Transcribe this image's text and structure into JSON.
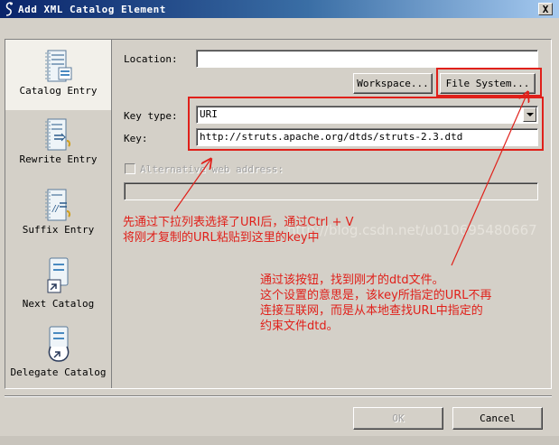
{
  "window": {
    "title": "Add XML Catalog Element",
    "close_label": "X"
  },
  "sidebar": {
    "items": [
      {
        "label": "Catalog Entry",
        "icon": "catalog-entry-icon",
        "selected": true
      },
      {
        "label": "Rewrite Entry",
        "icon": "rewrite-entry-icon",
        "selected": false
      },
      {
        "label": "Suffix Entry",
        "icon": "suffix-entry-icon",
        "selected": false
      },
      {
        "label": "Next Catalog",
        "icon": "next-catalog-icon",
        "selected": false
      },
      {
        "label": "Delegate Catalog",
        "icon": "delegate-catalog-icon",
        "selected": false
      }
    ]
  },
  "form": {
    "location_label": "Location:",
    "location_value": "",
    "workspace_button": "Workspace...",
    "file_system_button": "File System...",
    "key_type_label": "Key type:",
    "key_type_value": "URI",
    "key_label": "Key:",
    "key_value": "http://struts.apache.org/dtds/struts-2.3.dtd",
    "alt_web_label": "Alternative web address:",
    "alt_web_checked": false,
    "alt_web_value": ""
  },
  "annotations": {
    "note1": [
      "先通过下拉列表选择了URI后，通过Ctrl + V",
      "将刚才复制的URL粘贴到这里的key中"
    ],
    "note2": [
      "通过该按钮，找到刚才的dtd文件。",
      "这个设置的意思是，该key所指定的URL不再",
      "连接互联网，而是从本地查找URL中指定的",
      "约束文件dtd。"
    ],
    "watermark": "http://blog.csdn.net/u010695480667",
    "color": "#e0201a"
  },
  "footer": {
    "ok_button": "OK",
    "cancel_button": "Cancel",
    "ok_enabled": false
  }
}
